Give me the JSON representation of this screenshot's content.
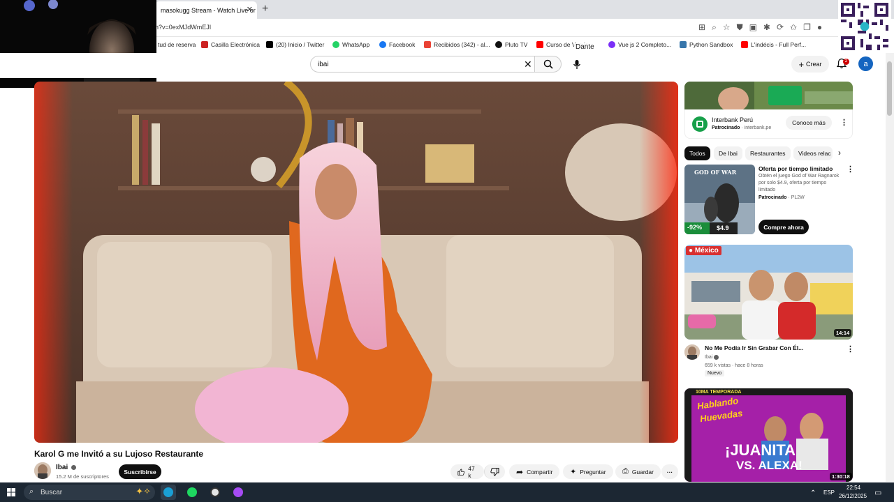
{
  "browser": {
    "tab_title": "masokugg Stream - Watch Live or",
    "tab_close": "✕",
    "new_tab": "+",
    "url": "h?v=0exMJdWmEJI",
    "bookmarks": [
      {
        "label": "tud de reserva",
        "color": "#ffffff"
      },
      {
        "label": "Casilla Electrónica",
        "color": "#cc2222"
      },
      {
        "label": "(20) Inicio / Twitter",
        "color": "#000000"
      },
      {
        "label": "WhatsApp",
        "color": "#25d366"
      },
      {
        "label": "Facebook",
        "color": "#1877f2"
      },
      {
        "label": "Recibidos (342) - al...",
        "color": "#ea4335"
      },
      {
        "label": "Pluto TV",
        "color": "#111111"
      },
      {
        "label": "Curso de Vue.js",
        "color": "#ff0000"
      },
      {
        "label": "Vue js 2 Completo...",
        "color": "#7b2ff7"
      },
      {
        "label": "Python Sandbox",
        "color": "#3776ab"
      },
      {
        "label": "L'indécis - Full Perf...",
        "color": "#ff0000"
      }
    ],
    "overlay_alt_text": "Dante"
  },
  "youtube": {
    "search_value": "ibai",
    "create_label": "Crear",
    "notifications_count": "2",
    "avatar_letter": "a",
    "video": {
      "title": "Karol G me Invitó a su Lujoso Restaurante",
      "channel": "Ibai",
      "subscribers": "15.2 M de suscriptores",
      "subscribe_label": "Suscribirse",
      "likes": "47 k",
      "share_label": "Compartir",
      "ask_label": "Preguntar",
      "save_label": "Guardar"
    },
    "ad": {
      "advertiser": "Interbank Perú",
      "sponsored": "Patrocinado",
      "domain": "interbank.pe",
      "cta": "Conoce más"
    },
    "chips": [
      "Todos",
      "De Ibai",
      "Restaurantes",
      "Videos relac"
    ],
    "promo": {
      "title": "Oferta por tiempo limitado",
      "description": "Obtén el juego God of War Ragnarok por solo $4.9, oferta por tiempo limitado",
      "sponsored": "Patrocinado",
      "advertiser": "PL2W",
      "cta": "Compre ahora",
      "discount": "-92%",
      "price": "$4.9",
      "game_title": "GOD OF WAR"
    },
    "recommendations": [
      {
        "title": "No Me Podía Ir Sin Grabar Con Él...",
        "channel": "Ibai",
        "views": "659 k vistas",
        "age": "hace 8 horas",
        "badge": "Nuevo",
        "duration": "14:14",
        "thumb_tag": "México"
      },
      {
        "duration": "1:30:18",
        "thumb_line1": "Hablando",
        "thumb_line2": "Huevadas",
        "thumb_line3": "¡JUANITA",
        "thumb_line4": "VS. ALEXA!",
        "thumb_banner": "10MA TEMPORADA"
      }
    ]
  },
  "taskbar": {
    "search_placeholder": "Buscar",
    "language": "ESP",
    "time": "22:54",
    "date": "26/12/2025"
  }
}
